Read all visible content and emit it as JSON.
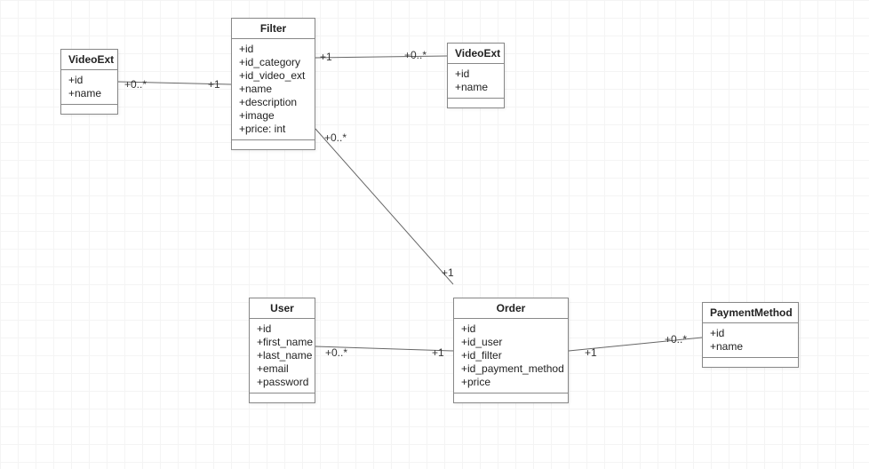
{
  "classes": {
    "videoExtLeft": {
      "title": "VideoExt",
      "attributes": [
        "+id",
        "+name"
      ]
    },
    "filter": {
      "title": "Filter",
      "attributes": [
        "+id",
        "+id_category",
        "+id_video_ext",
        "+name",
        "+description",
        "+image",
        "+price: int"
      ]
    },
    "videoExtRight": {
      "title": "VideoExt",
      "attributes": [
        "+id",
        "+name"
      ]
    },
    "user": {
      "title": "User",
      "attributes": [
        "+id",
        "+first_name",
        "+last_name",
        "+email",
        "+password"
      ]
    },
    "order": {
      "title": "Order",
      "attributes": [
        "+id",
        "+id_user",
        "+id_filter",
        "+id_payment_method",
        "+price"
      ]
    },
    "paymentMethod": {
      "title": "PaymentMethod",
      "attributes": [
        "+id",
        "+name"
      ]
    }
  },
  "multiplicities": {
    "videoExtLeft_far": "+0..*",
    "videoExtLeft_near_filter": "+1",
    "filter_right_near": "+1",
    "filter_right_far": "+0..*",
    "filter_down_near": "+0..*",
    "filter_down_far": "+1",
    "user_right_near": "+0..*",
    "user_right_far": "+1",
    "order_right_near": "+1",
    "order_right_far": "+0..*"
  }
}
